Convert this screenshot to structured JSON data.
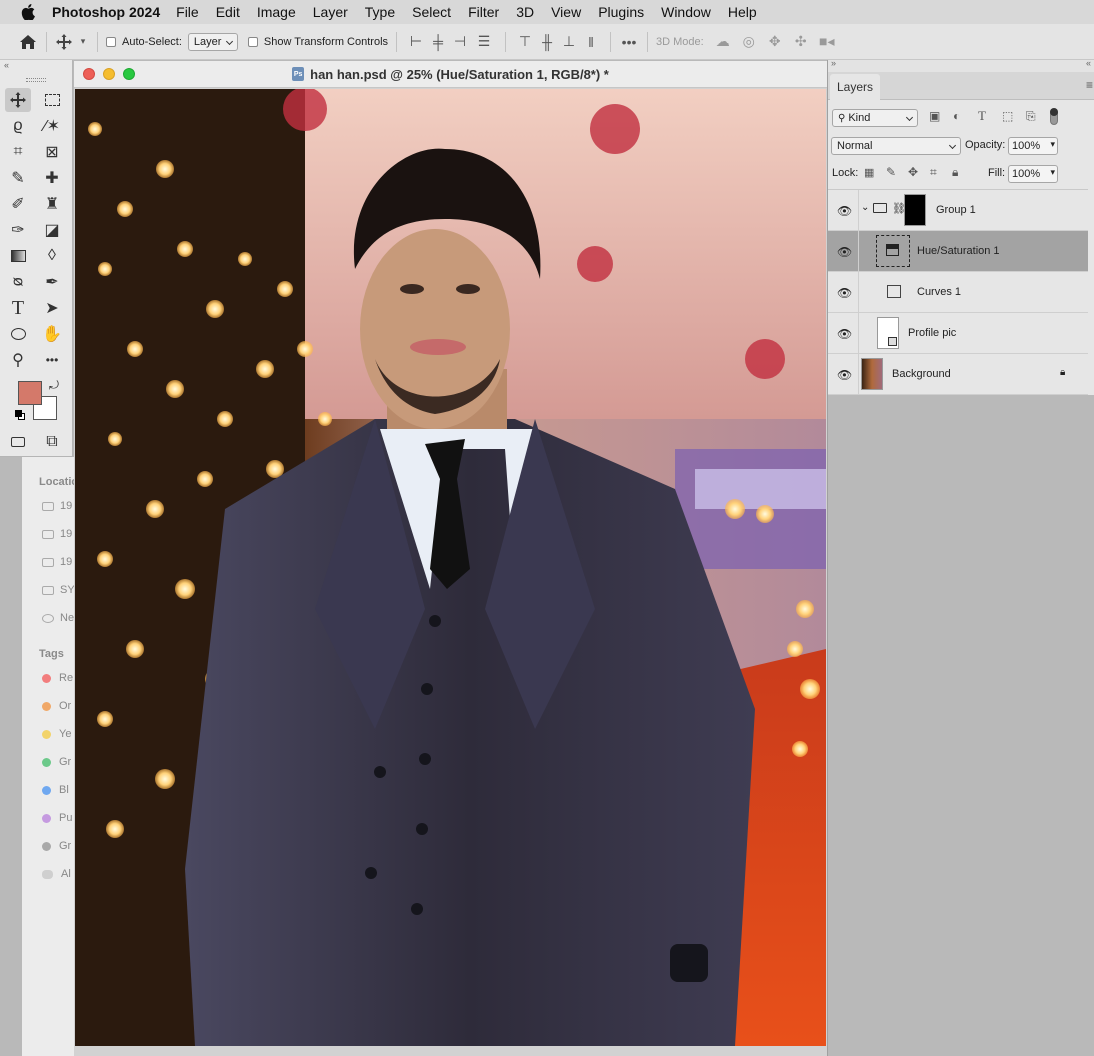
{
  "menubar": {
    "app_name": "Photoshop 2024",
    "items": [
      "File",
      "Edit",
      "Image",
      "Layer",
      "Type",
      "Select",
      "Filter",
      "3D",
      "View",
      "Plugins",
      "Window",
      "Help"
    ]
  },
  "options_bar": {
    "auto_select_label": "Auto-Select:",
    "auto_select_value": "Layer",
    "show_transform_label": "Show Transform Controls",
    "mode_3d_label": "3D Mode:"
  },
  "document": {
    "title": "han han.psd @ 25% (Hue/Saturation 1, RGB/8*) *"
  },
  "finder_sidebar": {
    "locations_header": "Locatio",
    "locations": [
      "19",
      "19",
      "19",
      "SY",
      "Ne"
    ],
    "tags_header": "Tags",
    "tags": [
      {
        "label": "Re",
        "color": "#f27d7d"
      },
      {
        "label": "Or",
        "color": "#f0a868"
      },
      {
        "label": "Ye",
        "color": "#f2d36a"
      },
      {
        "label": "Gr",
        "color": "#6cc98a"
      },
      {
        "label": "Bl",
        "color": "#6fa8f0"
      },
      {
        "label": "Pu",
        "color": "#c59ae0"
      },
      {
        "label": "Gr",
        "color": "#a9a9a9"
      },
      {
        "label": "Al",
        "color": "#cfcfcf"
      }
    ]
  },
  "colors": {
    "foreground": "#d4796a",
    "background": "#ffffff"
  },
  "layers_panel": {
    "tab_label": "Layers",
    "filter_value": "Kind",
    "blend_mode": "Normal",
    "opacity_label": "Opacity:",
    "opacity_value": "100%",
    "lock_label": "Lock:",
    "fill_label": "Fill:",
    "fill_value": "100%",
    "layers": [
      {
        "name": "Group 1"
      },
      {
        "name": "Hue/Saturation 1"
      },
      {
        "name": "Curves 1"
      },
      {
        "name": "Profile pic"
      },
      {
        "name": "Background"
      }
    ]
  }
}
